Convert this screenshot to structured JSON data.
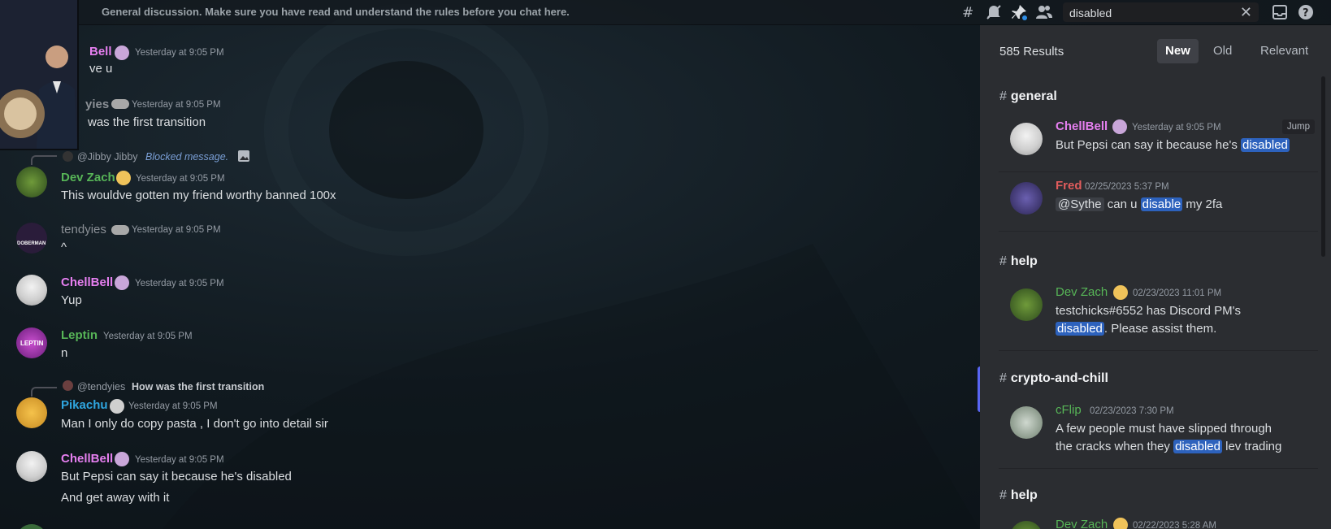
{
  "header": {
    "channel_name": "general",
    "topic": "General discussion. Make sure you have read and understand the rules before you chat here."
  },
  "search": {
    "value": "disabled",
    "clear_icon": "close-icon"
  },
  "colors": {
    "pink_name": "#e67ff0",
    "green_name": "#57b557",
    "blue_name": "#2fa6e0",
    "red_name": "#e05c5c",
    "gray_name": "#8b9096",
    "highlight": "#2d62bd"
  },
  "messages": [
    {
      "username": "ChellBell",
      "display_username": "Bell",
      "time": "Yesterday at 9:05 PM",
      "text": "love u",
      "display_text": "ve u"
    },
    {
      "username": "tendyies",
      "display_username": "yies",
      "time": "Yesterday at 9:05 PM",
      "text": "How was the first transition",
      "display_text": "was the first transition"
    },
    {
      "reply_user": "@Jibby Jibby",
      "reply_text": "Blocked message.",
      "username": "Dev Zach",
      "time": "Yesterday at 9:05 PM",
      "text": "This wouldve gotten my friend worthy banned 100x"
    },
    {
      "username": "tendyies",
      "time": "Yesterday at 9:05 PM",
      "text": "^",
      "avatar_text": "DOBERMAN"
    },
    {
      "username": "ChellBell",
      "time": "Yesterday at 9:05 PM",
      "text": "Yup"
    },
    {
      "username": "Leptin",
      "time": "Yesterday at 9:05 PM",
      "text": "n",
      "avatar_text": "LEPTIN"
    },
    {
      "reply_user": "@tendyies",
      "reply_text": "How was the first transition",
      "username": "Pikachu",
      "time": "Yesterday at 9:05 PM",
      "text": "Man I only do copy pasta , I don't go into detail sir"
    },
    {
      "username": "ChellBell",
      "time": "Yesterday at 9:05 PM",
      "text": "But Pepsi can say it because he's disabled",
      "text2": "And get away with it"
    }
  ],
  "results_panel": {
    "count": "585 Results",
    "sort_new": "New",
    "sort_old": "Old",
    "sort_relevant": "Relevant",
    "jump_label": "Jump",
    "groups": [
      {
        "channel": "general",
        "results": [
          {
            "username": "ChellBell",
            "time": "Yesterday at 9:05 PM",
            "text_before": "But Pepsi can say it because he's ",
            "highlight": "disabled",
            "text_after": ""
          },
          {
            "username": "Fred",
            "time": "02/25/2023 5:37 PM",
            "mention": "@Sythe",
            "text_before": " can u ",
            "highlight": "disable",
            "text_after": " my 2fa"
          }
        ]
      },
      {
        "channel": "help",
        "results": [
          {
            "username": "Dev Zach",
            "time": "02/23/2023 11:01 PM",
            "text_before": "testchicks#6552 has Discord PM's",
            "highlight": "disabled",
            "text_after": ". Please assist them."
          }
        ]
      },
      {
        "channel": "crypto-and-chill",
        "results": [
          {
            "username": "cFlip",
            "time": "02/23/2023 7:30 PM",
            "text_before": "A few people must have slipped through",
            "text_line2_before": "the cracks when they ",
            "highlight": "disabled",
            "text_after": " lev trading"
          }
        ]
      },
      {
        "channel": "help",
        "results": [
          {
            "username": "Dev Zach",
            "time": "02/22/2023 5:28 AM"
          }
        ]
      }
    ]
  }
}
